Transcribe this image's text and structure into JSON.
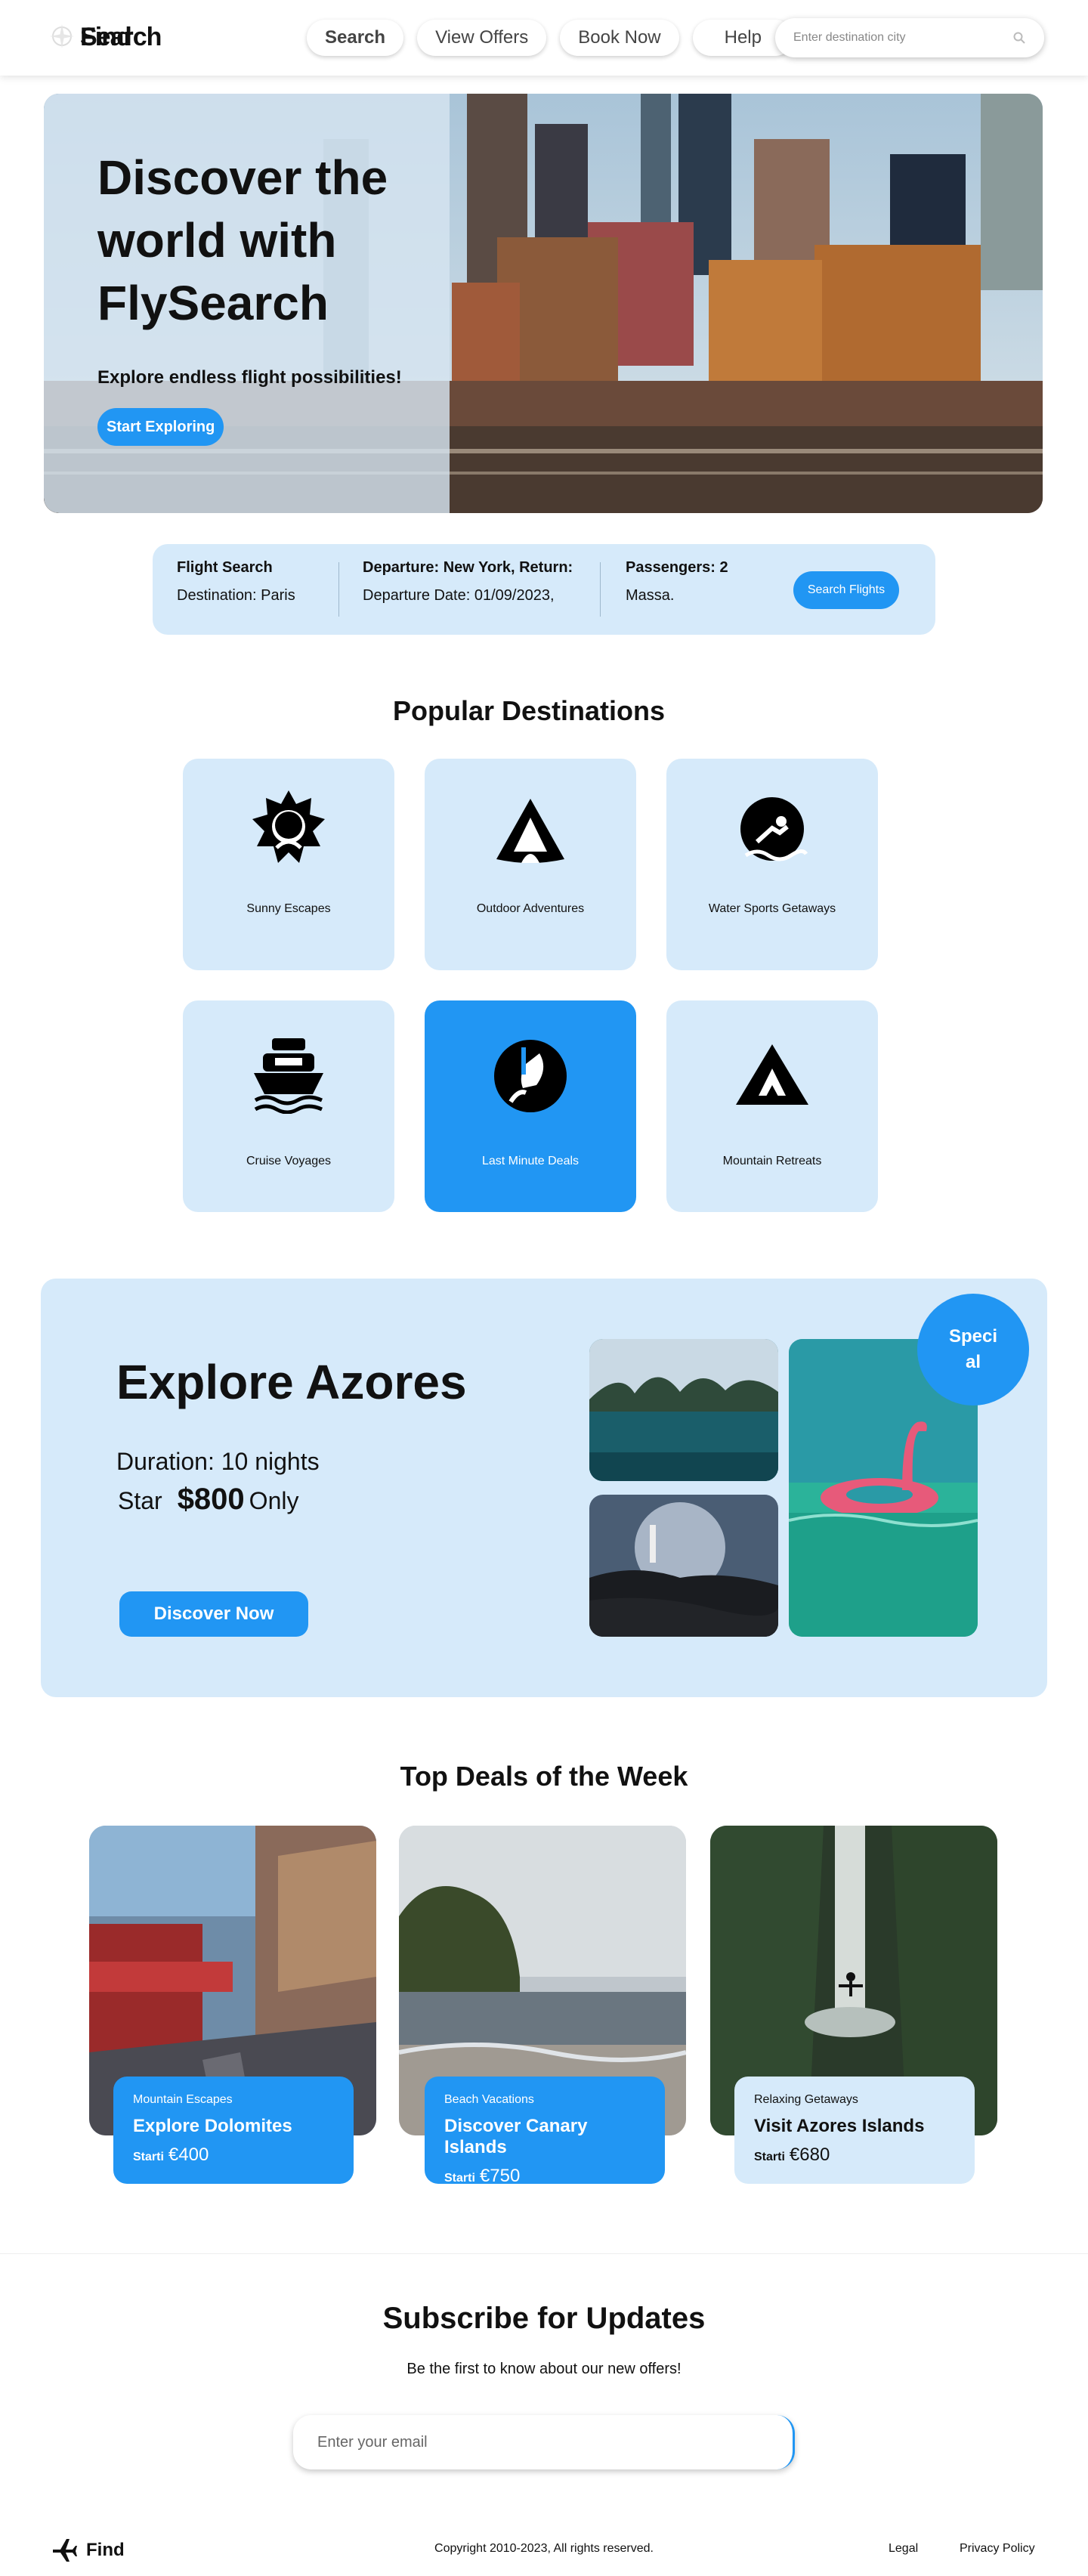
{
  "header": {
    "logo_text": "Search",
    "logo_overlap": "Find",
    "nav": [
      "Search",
      "View Offers",
      "Book Now",
      "Help"
    ],
    "search_placeholder": "Enter destination city"
  },
  "hero": {
    "title": "Discover the world with FlySearch",
    "subtitle": "Explore endless flight possibilities!",
    "button": "Start Exploring"
  },
  "flight_search": {
    "col1_title": "Flight Search",
    "col1_value": "Destination: Paris",
    "col2_title": "Departure: New York, Return:",
    "col2_value": "Departure Date: 01/09/2023,",
    "col3_title": "Passengers: 2",
    "col3_value": "Massa.",
    "button": "Search Flights"
  },
  "popular": {
    "title": "Popular Destinations",
    "items": [
      {
        "label": "Sunny Escapes",
        "icon": "sun-icon"
      },
      {
        "label": "Outdoor Adventures",
        "icon": "tent-icon"
      },
      {
        "label": "Water Sports Getaways",
        "icon": "surfer-icon"
      },
      {
        "label": "Cruise Voyages",
        "icon": "cruise-ship-icon"
      },
      {
        "label": "Last Minute Deals",
        "icon": "rocket-icon"
      },
      {
        "label": "Mountain Retreats",
        "icon": "mountain-icon"
      }
    ]
  },
  "azores": {
    "title": "Explore Azores",
    "duration": "Duration: 10 nights",
    "price_prefix": "Star",
    "price": "$800",
    "price_suffix": "Only",
    "button": "Discover Now",
    "badge": "Special"
  },
  "deals": {
    "title": "Top Deals of the Week",
    "items": [
      {
        "category": "Mountain Escapes",
        "name": "Explore Dolomites",
        "start": "Starti",
        "price": "€400"
      },
      {
        "category": "Beach Vacations",
        "name": "Discover Canary Islands",
        "start": "Starti",
        "price": "€750"
      },
      {
        "category": "Relaxing Getaways",
        "name": "Visit Azores Islands",
        "start": "Starti",
        "price": "€680"
      }
    ]
  },
  "subscribe": {
    "title": "Subscribe for Updates",
    "text": "Be the first to know about our new offers!",
    "placeholder": "Enter your email"
  },
  "footer": {
    "logo": "Find",
    "copyright": "Copyright 2010-2023, All rights reserved.",
    "links": [
      "Legal",
      "Privacy Policy"
    ]
  },
  "colors": {
    "accent": "#2196f3",
    "light": "#d6eafa"
  }
}
